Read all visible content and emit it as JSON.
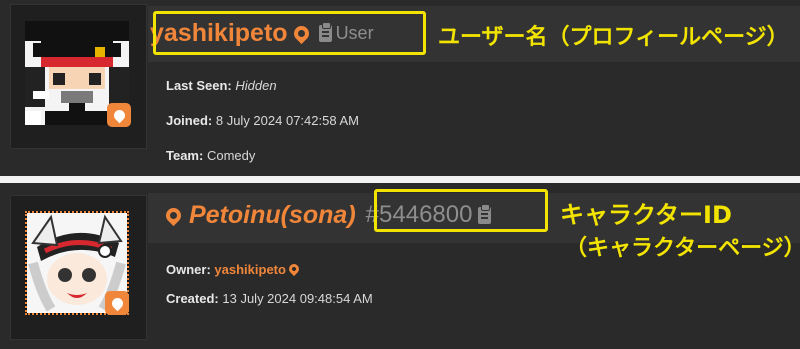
{
  "colors": {
    "accent": "#f0863a",
    "annotation": "#f2e400",
    "muted": "#8e8e8e"
  },
  "user_profile": {
    "username": "yashikipeto",
    "role": "User",
    "last_seen_label": "Last Seen:",
    "last_seen_value": "Hidden",
    "joined_label": "Joined:",
    "joined_value": "8 July 2024 07:42:58 AM",
    "team_label": "Team:",
    "team_value": "Comedy",
    "annotation": "ユーザー名（プロフィールページ）"
  },
  "character_profile": {
    "name": "Petoinu(sona)",
    "id": "#5446800",
    "owner_label": "Owner:",
    "owner_value": "yashikipeto",
    "created_label": "Created:",
    "created_value": "13 July 2024 09:48:54 AM",
    "annotation_line1": "キャラクターID",
    "annotation_line2": "（キャラクターページ）"
  },
  "icons": {
    "pin": "map-pin-icon",
    "clipboard": "clipboard-icon"
  }
}
